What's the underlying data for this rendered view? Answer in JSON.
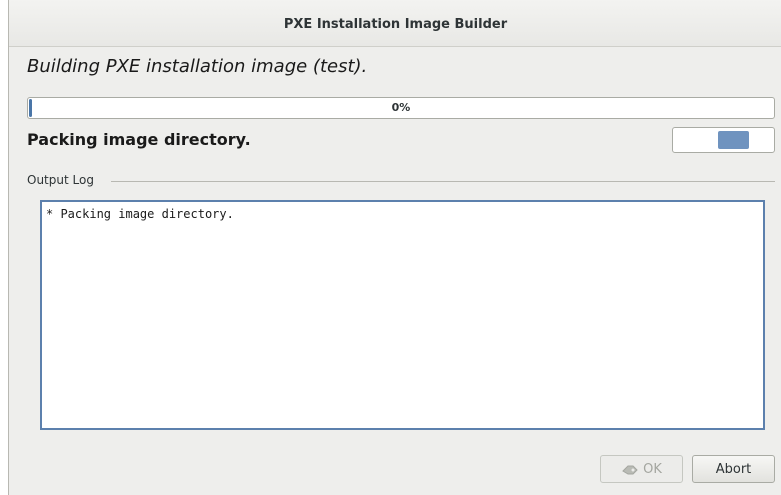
{
  "window": {
    "title": "PXE Installation Image Builder"
  },
  "main": {
    "heading": "Building PXE installation image (test).",
    "progress": {
      "value": 0,
      "label": "0%"
    },
    "status_text": "Packing image directory."
  },
  "output_log": {
    "label": "Output Log",
    "text": "* Packing image directory."
  },
  "buttons": {
    "ok_label": "OK",
    "ok_icon": "apply-icon",
    "abort_label": "Abort"
  },
  "colors": {
    "accent": "#4a76a8",
    "activity": "#6f93bf",
    "window_bg": "#eeeeec"
  }
}
